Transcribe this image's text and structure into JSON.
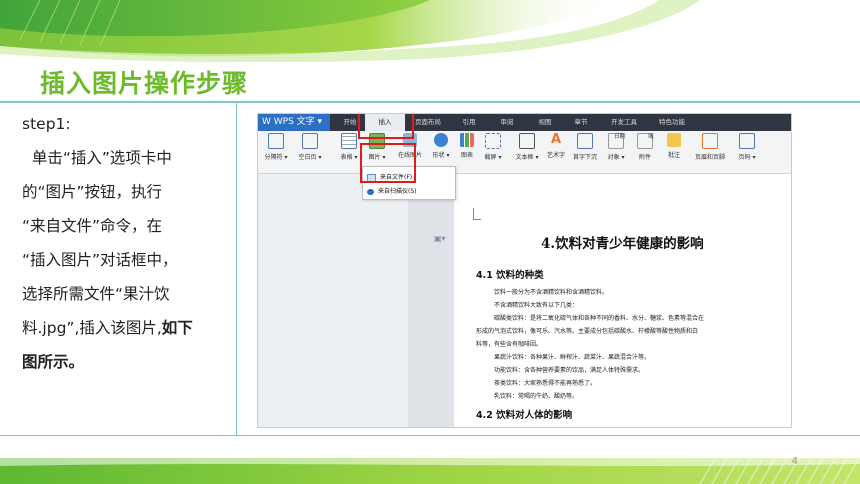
{
  "slide": {
    "title": "插入图片操作步骤",
    "step_label": "step1:",
    "paragraph_lines": [
      "  单击“插入”选项卡中",
      "的“图片”按钮，执行",
      "“来自文件”命令，在",
      "“插入图片”对话框中，",
      "选择所需文件“果汁饮",
      "料.jpg”,插入该图片,"
    ],
    "bold_tail_1": "如下",
    "bold_tail_2": "图所示。",
    "page_number": "4",
    "colors": {
      "title_green": "#6cbb2a",
      "rule_teal": "#7ec6c8",
      "highlight_red": "#e01b1b",
      "wps_blue": "#2d6fc4"
    }
  },
  "screenshot": {
    "app_button": "W WPS 文字 ▾",
    "menu_tabs": [
      "开始",
      "插入",
      "页面布局",
      "引用",
      "审阅",
      "视图",
      "章节",
      "开发工具",
      "特色功能"
    ],
    "ribbon_buttons": [
      "分隔符 ▾",
      "空白页 ▾",
      "表格 ▾",
      "图片 ▾",
      "在线图片",
      "形状 ▾",
      "图表",
      "截屏 ▾",
      "文本框 ▾",
      "艺术字",
      "首字下沉",
      "对象 ▾",
      "附件",
      "批注",
      "页眉和页脚",
      "页码 ▾"
    ],
    "ribbon_small": [
      "日期",
      "域"
    ],
    "dropdown_items": [
      "来自文件(F)",
      "来自扫描仪(S)"
    ],
    "document": {
      "title": "4.饮料对青少年健康的影响",
      "section_1": "4.1 饮料的种类",
      "lines": [
        "饮料一般分为不含酒精饮料和含酒精饮料。",
        "不含酒精饮料大致有以下几类：",
        "碳酸类饮料：是将二氧化碳气体和各种不同的香料、水分、糖浆、色素等混合在",
        "形成的气泡式饮料，像可乐、汽水等。主要成分包括碳酸水、柠檬酸等酸性物质和白",
        "料等，有些含有咖啡因。",
        "果蔬汁饮料：各种果汁、鲜榨汁、蔬菜汁、果蔬混合汁等。",
        "功能饮料：含各种营养要素的饮品，满足人体特殊需求。",
        "茶类饮料：大家熟悉得不能再熟悉了。",
        "乳饮料：常喝的牛奶、酸奶等。"
      ],
      "section_2": "4.2 饮料对人体的影响"
    }
  }
}
